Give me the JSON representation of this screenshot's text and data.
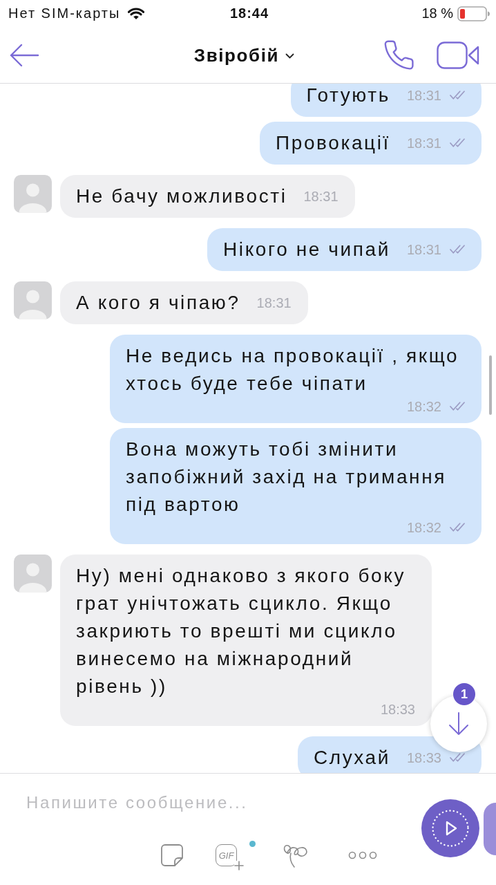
{
  "status_bar": {
    "carrier": "Нет SIM-карты",
    "time": "18:44",
    "battery": "18 %"
  },
  "header": {
    "title": "Звіробій"
  },
  "messages": [
    {
      "kind": "outgoing",
      "text": "Готують",
      "time": "18:31"
    },
    {
      "kind": "outgoing",
      "text": "Провокації",
      "time": "18:31"
    },
    {
      "kind": "incoming",
      "text": "Не бачу можливості",
      "time": "18:31"
    },
    {
      "kind": "outgoing",
      "text": "Нікого не чипай",
      "time": "18:31"
    },
    {
      "kind": "incoming",
      "text": "А кого я чіпаю?",
      "time": "18:31"
    },
    {
      "kind": "outgoing",
      "text": "Не ведись на провокації , якщо хтось буде тебе чіпати",
      "time": "18:32"
    },
    {
      "kind": "outgoing",
      "text": "Вона можуть тобі змінити запобіжний захід на тримання під вартою",
      "time": "18:32"
    },
    {
      "kind": "incoming",
      "text": "Ну) мені однаково з якого боку грат унічтожать сцикло. Якщо закриють то врешті ми сцикло винесемо на міжнародний рівень ))",
      "time": "18:33"
    },
    {
      "kind": "outgoing",
      "text": "Слухай",
      "time": "18:33"
    }
  ],
  "scroll_button": {
    "badge": "1"
  },
  "composer": {
    "placeholder": "Напишите сообщение...",
    "gif_label": "GIF"
  }
}
